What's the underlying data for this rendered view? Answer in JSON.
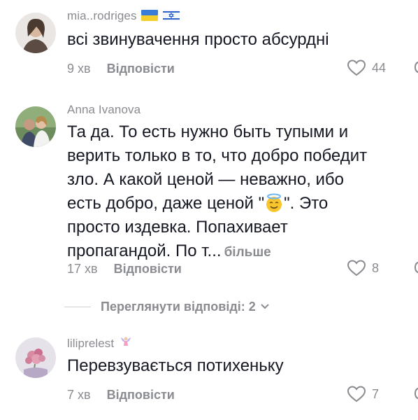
{
  "comments": [
    {
      "username": "mia..rodriges",
      "text": "всі звинувачення просто абсурдні",
      "time": "9 хв",
      "reply_label": "Відповісти",
      "likes": "44",
      "flags": [
        "ukraine-flag-icon",
        "israel-flag-icon"
      ]
    },
    {
      "username": "Anna Ivanova",
      "text_lines": [
        "Та да. То есть нужно быть тупыми и",
        "верить только в то, что добро победит",
        "зло. А какой ценой — неважно, ибо",
        "есть добро, даже ценой \"",
        "\". Это",
        "просто издевка. Попахивает",
        "пропагандой. По т..."
      ],
      "more_label": "більше",
      "emoji": "smiling-face-with-halo-emoji",
      "time": "17 хв",
      "reply_label": "Відповісти",
      "likes": "8"
    },
    {
      "username": "liliprelest",
      "badge": "fairy-emoji",
      "text": "Перевзувається потихеньку",
      "time": "7 хв",
      "reply_label": "Відповісти",
      "likes": "7"
    }
  ],
  "view_replies": {
    "label": "Переглянути відповіді: 2"
  },
  "colors": {
    "text": "#161823",
    "muted": "#8a8b91",
    "divider": "#d0d1d3"
  }
}
